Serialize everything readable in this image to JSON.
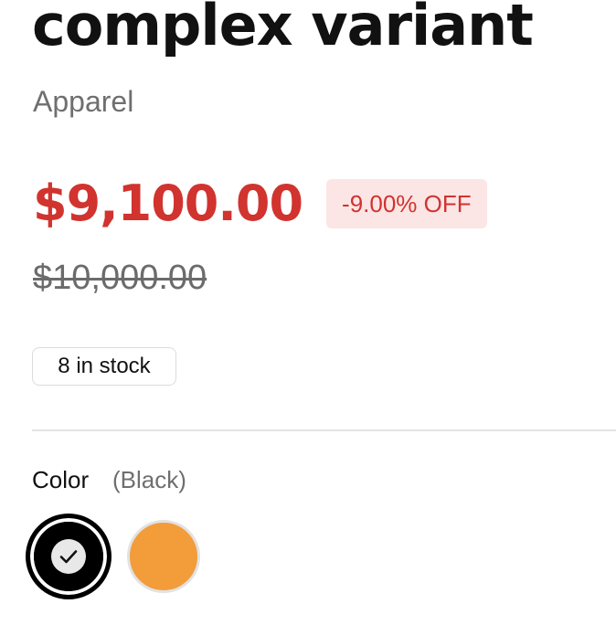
{
  "product": {
    "title": "complex variant",
    "category": "Apparel",
    "price": "$9,100.00",
    "discount": "-9.00% OFF",
    "old_price": "$10,000.00",
    "stock": "8 in stock"
  },
  "color_picker": {
    "label": "Color",
    "selected": "(Black)",
    "options": [
      {
        "name": "Black",
        "hex": "#000000",
        "selected": true
      },
      {
        "name": "Orange",
        "hex": "#f39c3a",
        "selected": false
      }
    ]
  },
  "colors": {
    "price_red": "#d1332f",
    "badge_bg": "#fce5e5",
    "muted_text": "#6f6f6f"
  }
}
